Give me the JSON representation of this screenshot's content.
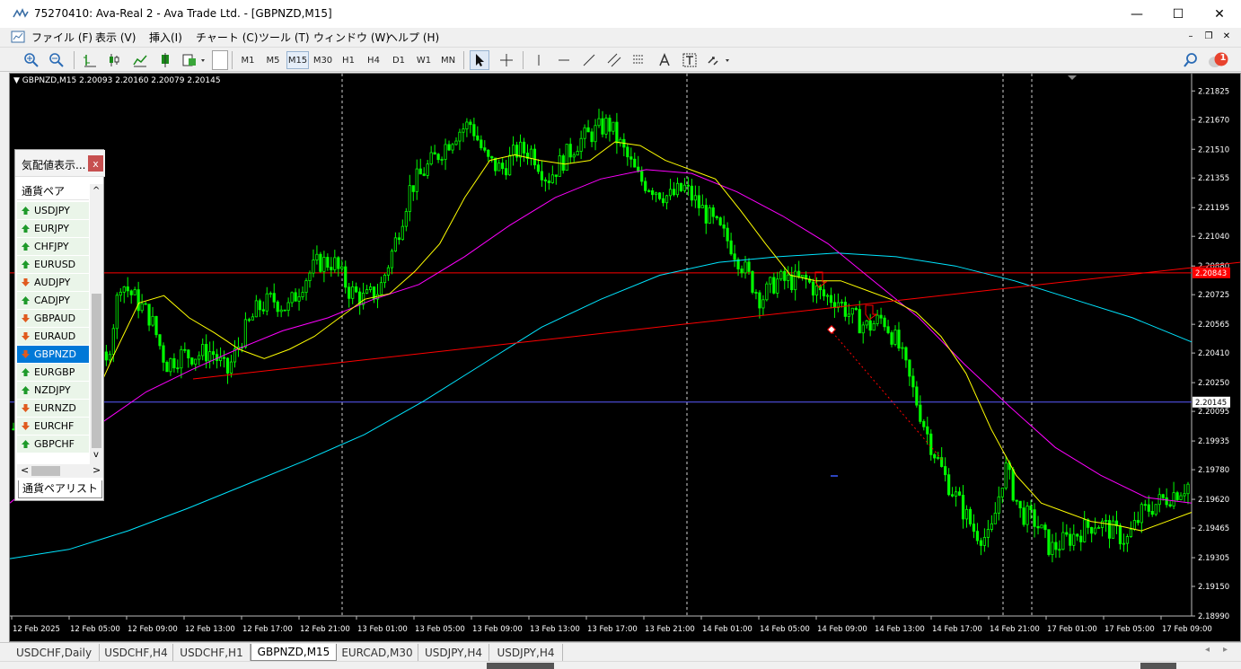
{
  "window": {
    "title": "75270410: Ava-Real 2 - Ava Trade Ltd. - [GBPNZD,M15]",
    "minimize": "—",
    "maximize": "☐",
    "close": "✕"
  },
  "menu": {
    "items": [
      "ファイル (F)",
      "表示 (V)",
      "挿入(I)",
      "チャート (C)",
      "ツール (T)",
      "ウィンドウ (W)",
      "ヘルプ (H)"
    ],
    "mdi_minimize": "–",
    "mdi_restore": "❐",
    "mdi_close": "✕"
  },
  "toolbar": {
    "timeframes": [
      "M1",
      "M5",
      "M15",
      "M30",
      "H1",
      "H4",
      "D1",
      "W1",
      "MN"
    ],
    "active_timeframe": "M15",
    "notification_count": "1"
  },
  "chart": {
    "header": "GBPNZD,M15  2.20093 2.20160 2.20079 2.20145",
    "current_price": "2.20145",
    "line_price": "2.20843",
    "colors": {
      "background": "#000000",
      "candle": "#00ff00",
      "ma_fast": "#ffff00",
      "ma_mid": "#ff00ff",
      "ma_slow": "#00e5ff",
      "trend": "#ff0000",
      "bid_line": "#5a5aff"
    }
  },
  "chart_data": {
    "type": "line",
    "title": "",
    "symbol": "GBPNZD",
    "timeframe": "M15",
    "y_ticks": [
      "2.21825",
      "2.21670",
      "2.21510",
      "2.21355",
      "2.21195",
      "2.21040",
      "2.20880",
      "2.20725",
      "2.20565",
      "2.20410",
      "2.20250",
      "2.20095",
      "2.19935",
      "2.19780",
      "2.19620",
      "2.19465",
      "2.19305",
      "2.19150",
      "2.18990"
    ],
    "x_ticks": [
      "12 Feb 2025",
      "12 Feb 05:00",
      "12 Feb 09:00",
      "12 Feb 13:00",
      "12 Feb 17:00",
      "12 Feb 21:00",
      "13 Feb 01:00",
      "13 Feb 05:00",
      "13 Feb 09:00",
      "13 Feb 13:00",
      "13 Feb 17:00",
      "13 Feb 21:00",
      "14 Feb 01:00",
      "14 Feb 05:00",
      "14 Feb 09:00",
      "14 Feb 13:00",
      "14 Feb 17:00",
      "14 Feb 21:00",
      "17 Feb 01:00",
      "17 Feb 05:00",
      "17 Feb 09:00"
    ],
    "ylim": [
      2.1899,
      2.2187
    ],
    "close_path": [
      2.2,
      2.204,
      2.2085,
      2.2075,
      2.2075,
      2.207,
      2.203,
      2.208,
      2.207,
      2.206,
      2.2035,
      2.204,
      2.204,
      2.2042,
      2.203,
      2.205,
      2.2065,
      2.207,
      2.2065,
      2.208,
      2.209,
      2.209,
      2.2075,
      2.207,
      2.2075,
      2.21,
      2.213,
      2.214,
      2.215,
      2.216,
      2.2165,
      2.2145,
      2.214,
      2.215,
      2.215,
      2.2135,
      2.2145,
      2.2155,
      2.216,
      2.2165,
      2.215,
      2.2135,
      2.213,
      2.2125,
      2.213,
      2.212,
      2.211,
      2.21,
      2.2085,
      2.207,
      2.208,
      2.208,
      2.208,
      2.2072,
      2.207,
      2.206,
      2.2055,
      2.206,
      2.2045,
      2.202,
      2.1995,
      2.1975,
      2.196,
      2.1945,
      2.194,
      2.198,
      2.1955,
      2.195,
      2.1935,
      2.194,
      2.1945,
      2.195,
      2.1945,
      2.194,
      2.1955,
      2.196,
      2.1965,
      2.197
    ],
    "ma_fast": [
      2.198,
      2.201,
      2.204,
      2.2068,
      2.2072,
      2.206,
      2.2052,
      2.2043,
      2.2038,
      2.2043,
      2.205,
      2.206,
      2.207,
      2.2073,
      2.2085,
      2.21,
      2.2125,
      2.2145,
      2.2148,
      2.2145,
      2.2143,
      2.2145,
      2.2155,
      2.2153,
      2.2145,
      2.214,
      2.2135,
      2.2118,
      2.21,
      2.2083,
      2.208,
      2.208,
      2.2075,
      2.207,
      2.2063,
      2.205,
      2.203,
      2.2,
      2.1975,
      2.196,
      2.1955,
      2.195,
      2.1948,
      2.1945,
      2.195,
      2.1955
    ],
    "ma_mid": [
      2.196,
      2.198,
      2.2003,
      2.202,
      2.2032,
      2.2043,
      2.2053,
      2.206,
      2.207,
      2.2078,
      2.2093,
      2.211,
      2.2125,
      2.2135,
      2.214,
      2.2138,
      2.2128,
      2.2115,
      2.21,
      2.208,
      2.206,
      2.2035,
      2.2012,
      2.199,
      2.1975,
      2.1963,
      2.196
    ],
    "ma_slow": [
      2.193,
      2.1935,
      2.1945,
      2.1957,
      2.197,
      2.1983,
      2.1997,
      2.2015,
      2.2035,
      2.2055,
      2.207,
      2.2083,
      2.209,
      2.2093,
      2.2095,
      2.2093,
      2.2088,
      2.208,
      2.207,
      2.206,
      2.2047
    ],
    "trend_line": {
      "from": "12 Feb 13:00",
      "to": "17 Feb 09:00",
      "y_start": 2.2027,
      "y_end": 2.209
    },
    "horizontal_line": 2.20843,
    "bid_line": 2.20145
  },
  "market_watch": {
    "title": "気配値表示...",
    "close": "x",
    "column_header": "通貨ペア",
    "tab_label": "通貨ペアリスト",
    "scroll_up": "^",
    "scroll_down": "v",
    "scroll_left": "<",
    "scroll_right": ">",
    "rows": [
      {
        "symbol": "USDJPY",
        "dir": "up"
      },
      {
        "symbol": "EURJPY",
        "dir": "up"
      },
      {
        "symbol": "CHFJPY",
        "dir": "up"
      },
      {
        "symbol": "EURUSD",
        "dir": "up"
      },
      {
        "symbol": "AUDJPY",
        "dir": "down"
      },
      {
        "symbol": "CADJPY",
        "dir": "up"
      },
      {
        "symbol": "GBPAUD",
        "dir": "down"
      },
      {
        "symbol": "EURAUD",
        "dir": "down"
      },
      {
        "symbol": "GBPNZD",
        "dir": "down"
      },
      {
        "symbol": "EURGBP",
        "dir": "up"
      },
      {
        "symbol": "NZDJPY",
        "dir": "up"
      },
      {
        "symbol": "EURNZD",
        "dir": "down"
      },
      {
        "symbol": "EURCHF",
        "dir": "down"
      },
      {
        "symbol": "GBPCHF",
        "dir": "up"
      }
    ],
    "selected": "GBPNZD"
  },
  "chart_tabs": [
    "USDCHF,Daily",
    "USDCHF,H4",
    "USDCHF,H1",
    "GBPNZD,M15",
    "EURCAD,M30",
    "USDJPY,H4",
    "USDJPY,H4"
  ],
  "active_chart_tab": "GBPNZD,M15"
}
